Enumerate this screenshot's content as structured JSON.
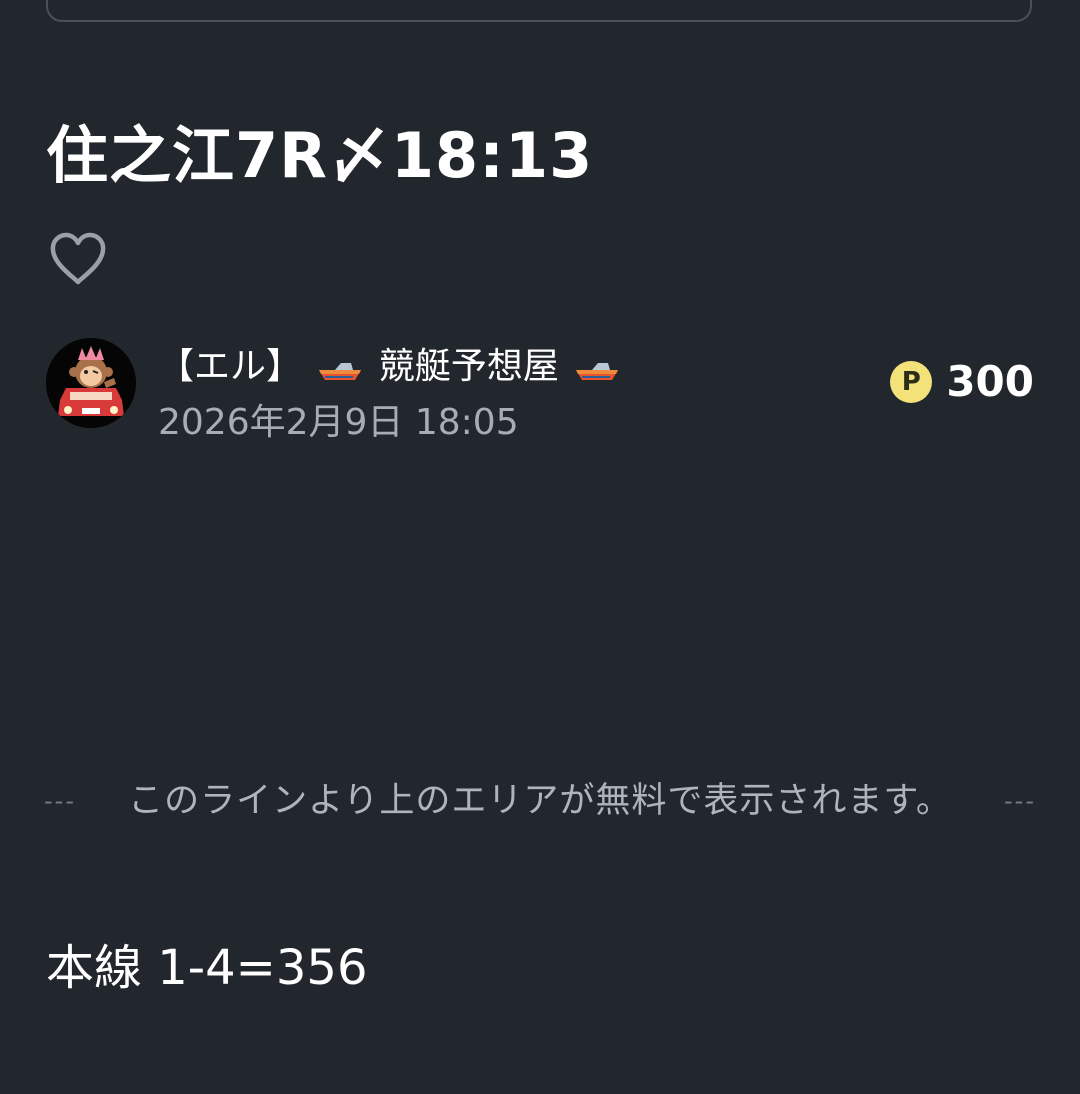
{
  "article": {
    "title": "住之江7R〆18:13",
    "body_text": "本線 1-4=356"
  },
  "like": {
    "icon": "heart-outline-icon"
  },
  "author": {
    "avatar_icon": "monkey-in-car-avatar",
    "name_prefix": "【エル】",
    "name_main": "競艇予想屋",
    "boat_icon": "speedboat-icon",
    "post_date": "2026年2月9日 18:05"
  },
  "price": {
    "icon": "point-coin-icon",
    "icon_letter": "P",
    "value": "300",
    "coin_color": "#f3e17a"
  },
  "paywall": {
    "dashes_left": "---",
    "text": "このラインより上のエリアが無料で表示されます。",
    "dashes_right": "---"
  },
  "colors": {
    "background": "#22272e",
    "text": "#ffffff",
    "muted_text": "#a7adb5"
  }
}
